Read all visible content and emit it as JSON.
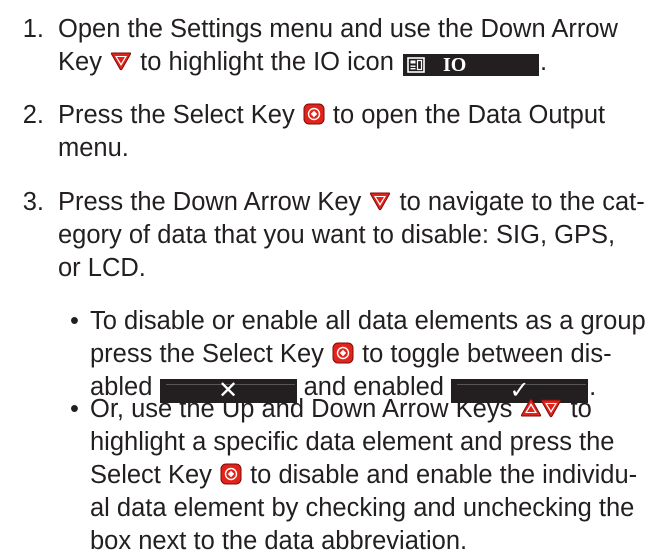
{
  "steps": [
    {
      "number": "1.",
      "line1_a": "Open the Settings menu and use the Down Arrow",
      "line2_a": "Key",
      "line2_b": "to highlight the IO icon",
      "io_label": "IO",
      "end": "."
    },
    {
      "number": "2.",
      "line1_a": "Press the Select Key",
      "line1_b": "to open the Data Output",
      "line2": "menu."
    },
    {
      "number": "3.",
      "line1_a": "Press the Down Arrow Key",
      "line1_b": "to navigate to the cat-",
      "line2": "egory of data that you want to disable: SIG, GPS,",
      "line3": "or LCD."
    }
  ],
  "bullets": [
    {
      "dot": "•",
      "line1": "To disable or enable all data elements as a group",
      "line2_a": "press the Select Key",
      "line2_b": "to toggle between dis-",
      "line3_a": "abled",
      "disabled_glyph": "✕",
      "line3_b": "and enabled",
      "enabled_glyph": "✓",
      "end": "."
    },
    {
      "dot": "•",
      "line1_a": "Or, use the Up and Down Arrow Keys",
      "line1_b": "to",
      "line2": "highlight a specific data element and press the",
      "line3_a": "Select Key",
      "line3_b": "to disable and enable the individu-",
      "line4": "al data element by checking and unchecking the",
      "line5": "box next to the data abbreviation."
    }
  ],
  "colors": {
    "key_red": "#e2231a",
    "text": "#231f20",
    "badge": "#231f20"
  },
  "icons": {
    "down": "down-arrow-key-icon",
    "up": "up-arrow-key-icon",
    "select": "select-key-icon",
    "io": "io-icon"
  }
}
